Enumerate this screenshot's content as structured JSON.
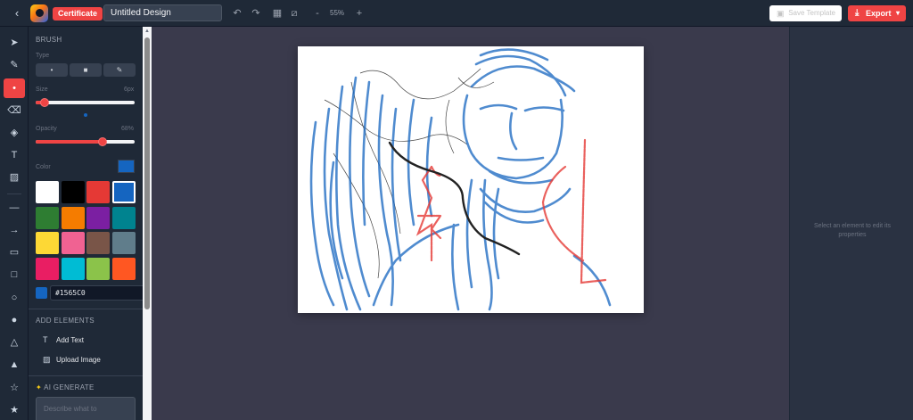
{
  "topbar": {
    "badge": "Certificate",
    "design_title": "Untitled Design",
    "zoom_minus": "-",
    "zoom_level": "55%",
    "zoom_plus": "+",
    "save_label": "Save Template",
    "export_label": "Export"
  },
  "brush": {
    "section_title": "BRUSH",
    "type_label": "Type",
    "size_label": "Size",
    "size_value": "6px",
    "size": 6,
    "opacity_label": "Opacity",
    "opacity_value": "68%",
    "opacity": 0.68,
    "color_label": "Color",
    "current_color": "#1565C0",
    "palette": [
      "#ffffff",
      "#000000",
      "#e53935",
      "#1565c0",
      "#2e7d32",
      "#f57c00",
      "#7b1fa2",
      "#00838f",
      "#fdd835",
      "#f06292",
      "#795548",
      "#607d8b",
      "#e91e63",
      "#00bcd4",
      "#8bc34a",
      "#ff5722"
    ]
  },
  "add_elements": {
    "title": "ADD ELEMENTS",
    "add_text": "Add Text",
    "upload_image": "Upload Image"
  },
  "ai": {
    "title": "AI GENERATE",
    "placeholder": "Describe what to"
  },
  "properties": {
    "hint": "Select an element to edit its properties"
  },
  "colors": {
    "accent": "#ef4444",
    "brush_blue": "#1565c0",
    "stroke_black": "#222222",
    "stroke_red": "#e53935"
  }
}
